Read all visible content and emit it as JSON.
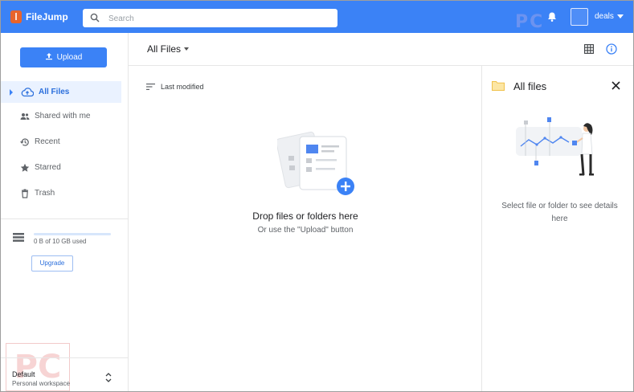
{
  "header": {
    "brand": "FileJump",
    "search_placeholder": "Search",
    "username": "deals",
    "watermark": "PC"
  },
  "sidebar": {
    "upload_label": "Upload",
    "items": [
      {
        "label": "All Files",
        "icon": "cloud-icon",
        "active": true
      },
      {
        "label": "Shared with me",
        "icon": "people-icon"
      },
      {
        "label": "Recent",
        "icon": "history-icon"
      },
      {
        "label": "Starred",
        "icon": "star-icon"
      },
      {
        "label": "Trash",
        "icon": "trash-icon"
      }
    ],
    "storage": {
      "text": "0 B of 10 GB used",
      "used_fraction": 0
    },
    "upgrade_label": "Upgrade",
    "workspace": {
      "name": "Default",
      "subtitle": "Personal workspace"
    },
    "watermark": "PC"
  },
  "main": {
    "breadcrumb": "All Files",
    "sort_label": "Last modified",
    "empty_title": "Drop files or folders here",
    "empty_subtitle": "Or use the \"Upload\" button"
  },
  "details": {
    "title": "All files",
    "message": "Select file or folder to see details here"
  },
  "colors": {
    "accent": "#3b82f6",
    "active_bg": "#eaf2ff",
    "folder": "#f5c542"
  }
}
